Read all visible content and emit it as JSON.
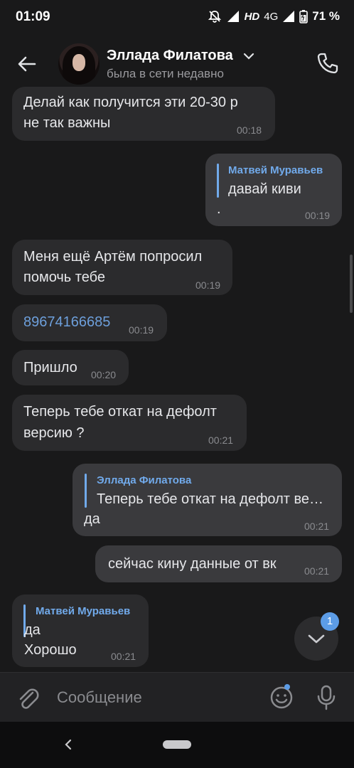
{
  "status_bar": {
    "time": "01:09",
    "hd": "HD",
    "network": "4G",
    "battery": "71 %"
  },
  "header": {
    "name": "Эллада Филатова",
    "status": "была в сети недавно"
  },
  "messages": [
    {
      "line1": "Делай как получится эти 20-30 р",
      "line2": "не так важны",
      "time": "00:18"
    },
    {
      "reply_author": "Матвей Муравьев",
      "reply_text": "давай киви",
      "text": ".",
      "time": "00:19"
    },
    {
      "line1": "Меня ещё Артём попросил",
      "line2": "помочь тебе",
      "time": "00:19"
    },
    {
      "text": "89674166685",
      "time": "00:19"
    },
    {
      "text": "Пришло",
      "time": "00:20"
    },
    {
      "line1": "Теперь тебе откат на дефолт",
      "line2": "версию ?",
      "time": "00:21"
    },
    {
      "reply_author": "Эллада Филатова",
      "reply_text": "Теперь тебе откат на дефолт ве…",
      "text": "да",
      "time": "00:21"
    },
    {
      "text": "сейчас кину данные от вк",
      "time": "00:21"
    },
    {
      "reply_author": "Матвей Муравьев",
      "reply_text": "да",
      "text": "Хорошо",
      "time": "00:21"
    }
  ],
  "fab": {
    "badge": "1"
  },
  "composer": {
    "placeholder": "Сообщение"
  },
  "colors": {
    "background": "#19191a",
    "bubble_in": "#2b2b2d",
    "bubble_out": "#3a3a3d",
    "accent": "#71aaeb",
    "link": "#6d9fdb"
  },
  "icons": [
    "back-arrow-icon",
    "chevron-down-icon",
    "phone-icon",
    "paperclip-icon",
    "smile-icon",
    "microphone-icon",
    "chevron-down-icon"
  ]
}
